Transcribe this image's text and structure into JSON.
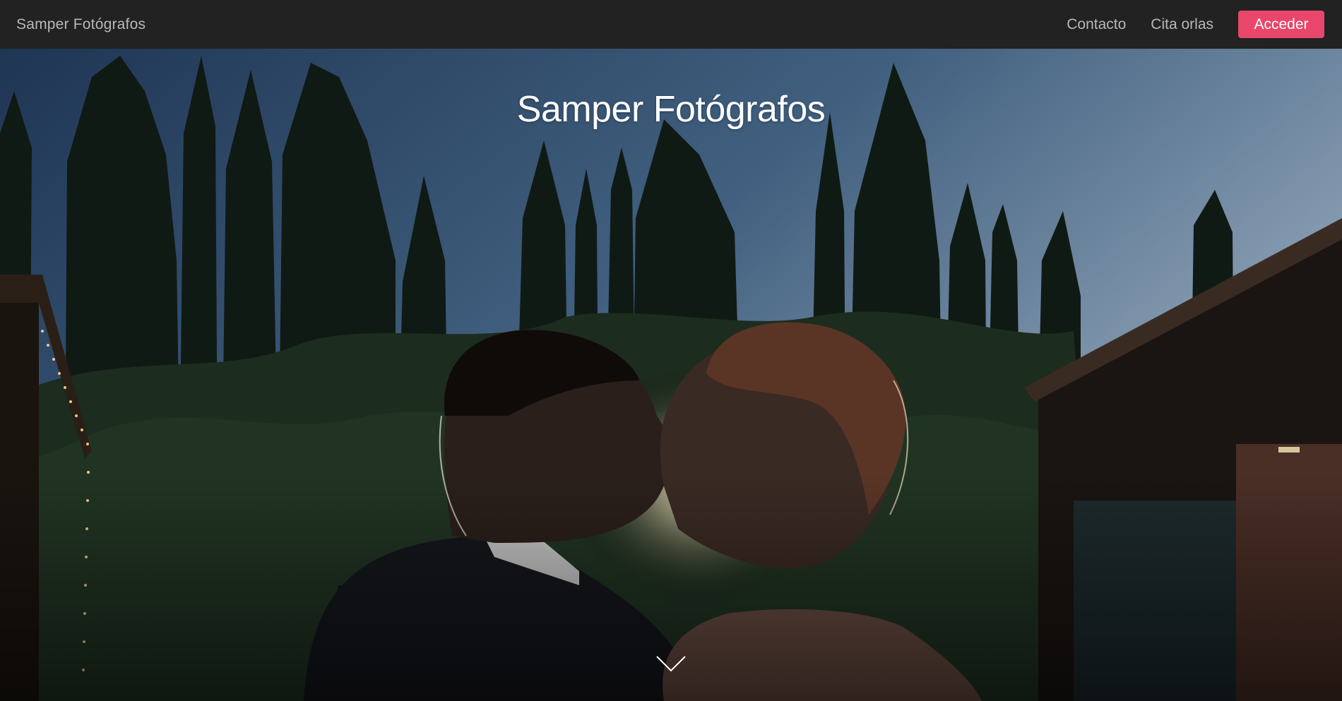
{
  "navbar": {
    "brand": "Samper Fotógrafos",
    "links": [
      {
        "label": "Contacto"
      },
      {
        "label": "Cita orlas"
      }
    ],
    "login_button": "Acceder"
  },
  "hero": {
    "title": "Samper Fotógrafos",
    "scroll_icon": "chevron-down-icon",
    "background": "wedding-couple-kissing-photo"
  },
  "colors": {
    "navbar_bg": "#222222",
    "nav_text": "#b8b8b8",
    "accent": "#e8466a",
    "hero_title": "#ffffff"
  }
}
